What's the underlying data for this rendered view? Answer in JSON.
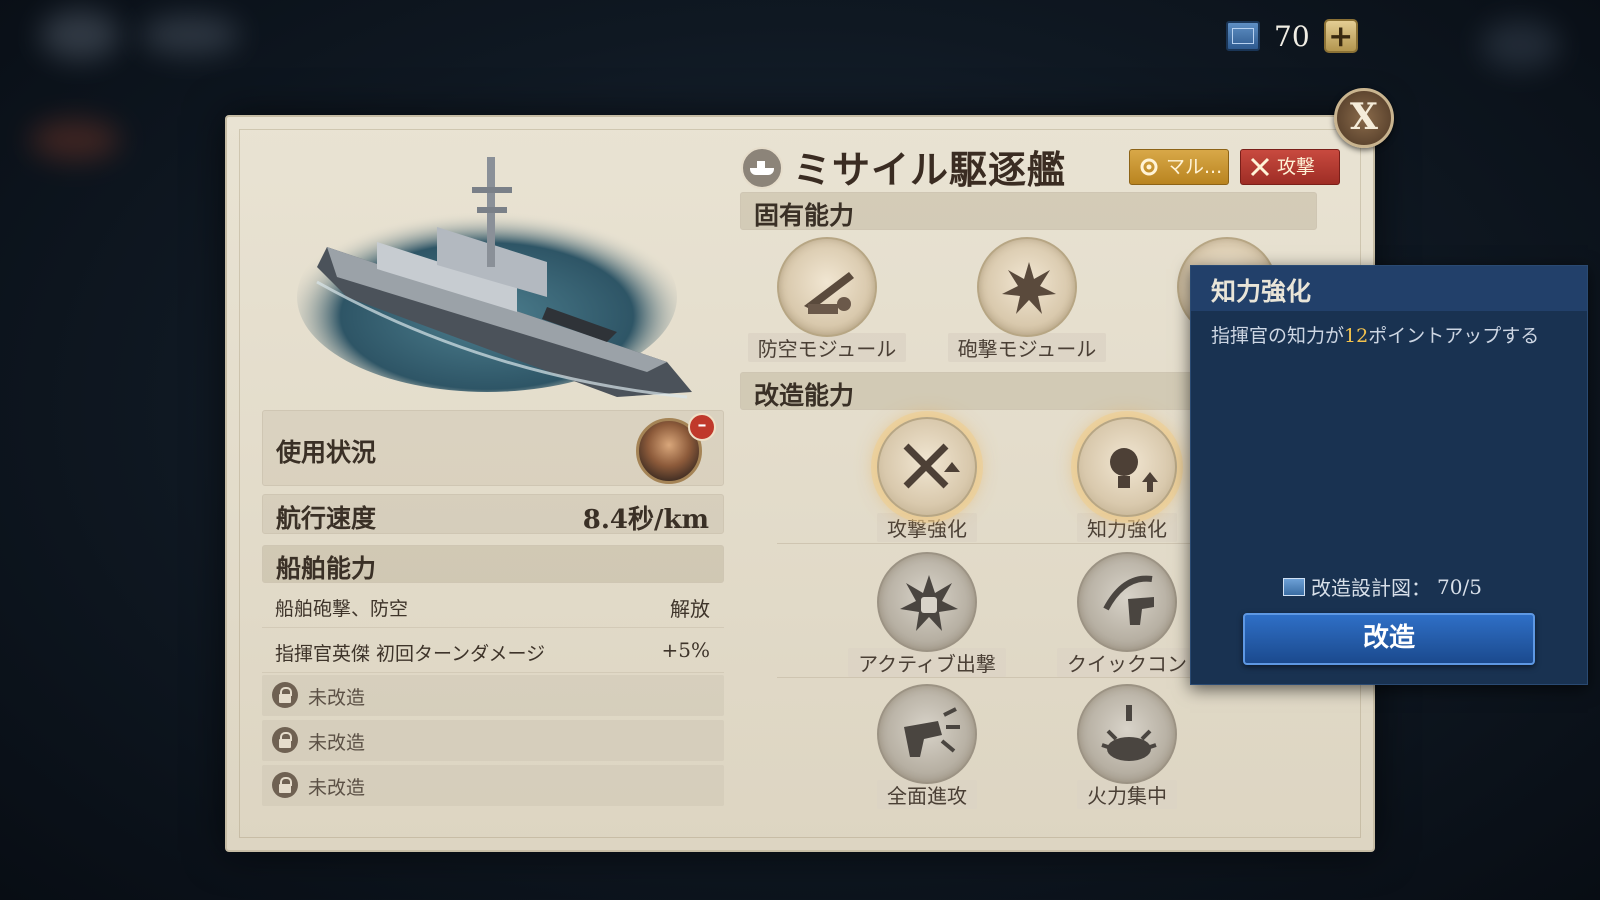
{
  "top_bar": {
    "blueprint_count": "70",
    "plus_label": "+"
  },
  "close_label": "X",
  "ship": {
    "title": "ミサイル駆逐艦",
    "tags": [
      {
        "label": "マル..."
      },
      {
        "label": "攻撃"
      }
    ]
  },
  "left": {
    "status_label": "使用状況",
    "remove_label": "–",
    "speed_label": "航行速度",
    "speed_value": "8.4秒/km",
    "ability_header": "船舶能力",
    "abilities": [
      {
        "label": "船舶砲撃、防空",
        "value": "解放"
      },
      {
        "label": "指揮官英傑 初回ターンダメージ",
        "value": "+5%"
      }
    ],
    "locked": [
      "未改造",
      "未改造",
      "未改造"
    ]
  },
  "inherent": {
    "header": "固有能力",
    "skills": [
      "防空モジュール",
      "砲撃モジュール"
    ]
  },
  "remodel": {
    "header": "改造能力",
    "skills": [
      "攻撃強化",
      "知力強化",
      "アクティブ出撃",
      "クイックコン",
      "全面進攻",
      "火力集中"
    ]
  },
  "tooltip": {
    "title": "知力強化",
    "desc_prefix": "指揮官の知力が",
    "desc_value": "12",
    "desc_suffix": "ポイントアップする",
    "cost_label": "改造設計図：",
    "cost_value": "70/5",
    "button_label": "改造"
  }
}
